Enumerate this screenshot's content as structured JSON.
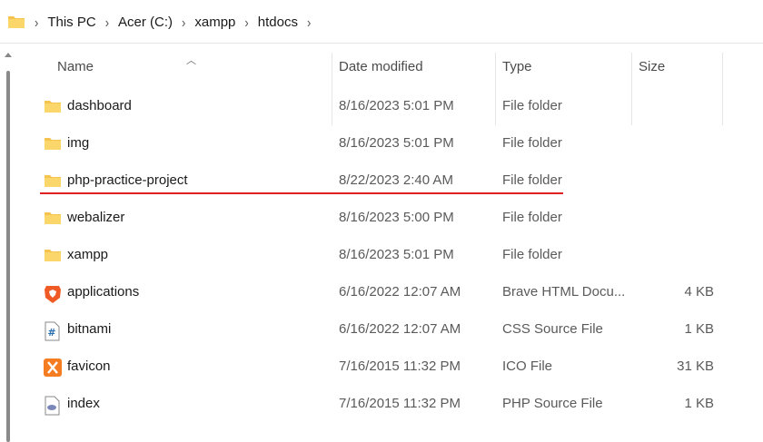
{
  "breadcrumb": {
    "items": [
      "This PC",
      "Acer (C:)",
      "xampp",
      "htdocs"
    ]
  },
  "columns": {
    "name": "Name",
    "date": "Date modified",
    "type": "Type",
    "size": "Size"
  },
  "files": [
    {
      "name": "dashboard",
      "date": "8/16/2023 5:01 PM",
      "type": "File folder",
      "size": "",
      "icon": "folder-icon"
    },
    {
      "name": "img",
      "date": "8/16/2023 5:01 PM",
      "type": "File folder",
      "size": "",
      "icon": "folder-icon"
    },
    {
      "name": "php-practice-project",
      "date": "8/22/2023 2:40 AM",
      "type": "File folder",
      "size": "",
      "icon": "folder-icon"
    },
    {
      "name": "webalizer",
      "date": "8/16/2023 5:00 PM",
      "type": "File folder",
      "size": "",
      "icon": "folder-icon"
    },
    {
      "name": "xampp",
      "date": "8/16/2023 5:01 PM",
      "type": "File folder",
      "size": "",
      "icon": "folder-icon"
    },
    {
      "name": "applications",
      "date": "6/16/2022 12:07 AM",
      "type": "Brave HTML Docu...",
      "size": "4 KB",
      "icon": "brave-html-icon"
    },
    {
      "name": "bitnami",
      "date": "6/16/2022 12:07 AM",
      "type": "CSS Source File",
      "size": "1 KB",
      "icon": "css-file-icon"
    },
    {
      "name": "favicon",
      "date": "7/16/2015 11:32 PM",
      "type": "ICO File",
      "size": "31 KB",
      "icon": "xampp-ico-icon"
    },
    {
      "name": "index",
      "date": "7/16/2015 11:32 PM",
      "type": "PHP Source File",
      "size": "1 KB",
      "icon": "php-file-icon"
    }
  ],
  "colors": {
    "folder": "#f4c44e",
    "annotation": "#e02020",
    "brave": "#f05a24",
    "xampp": "#f57c20"
  }
}
